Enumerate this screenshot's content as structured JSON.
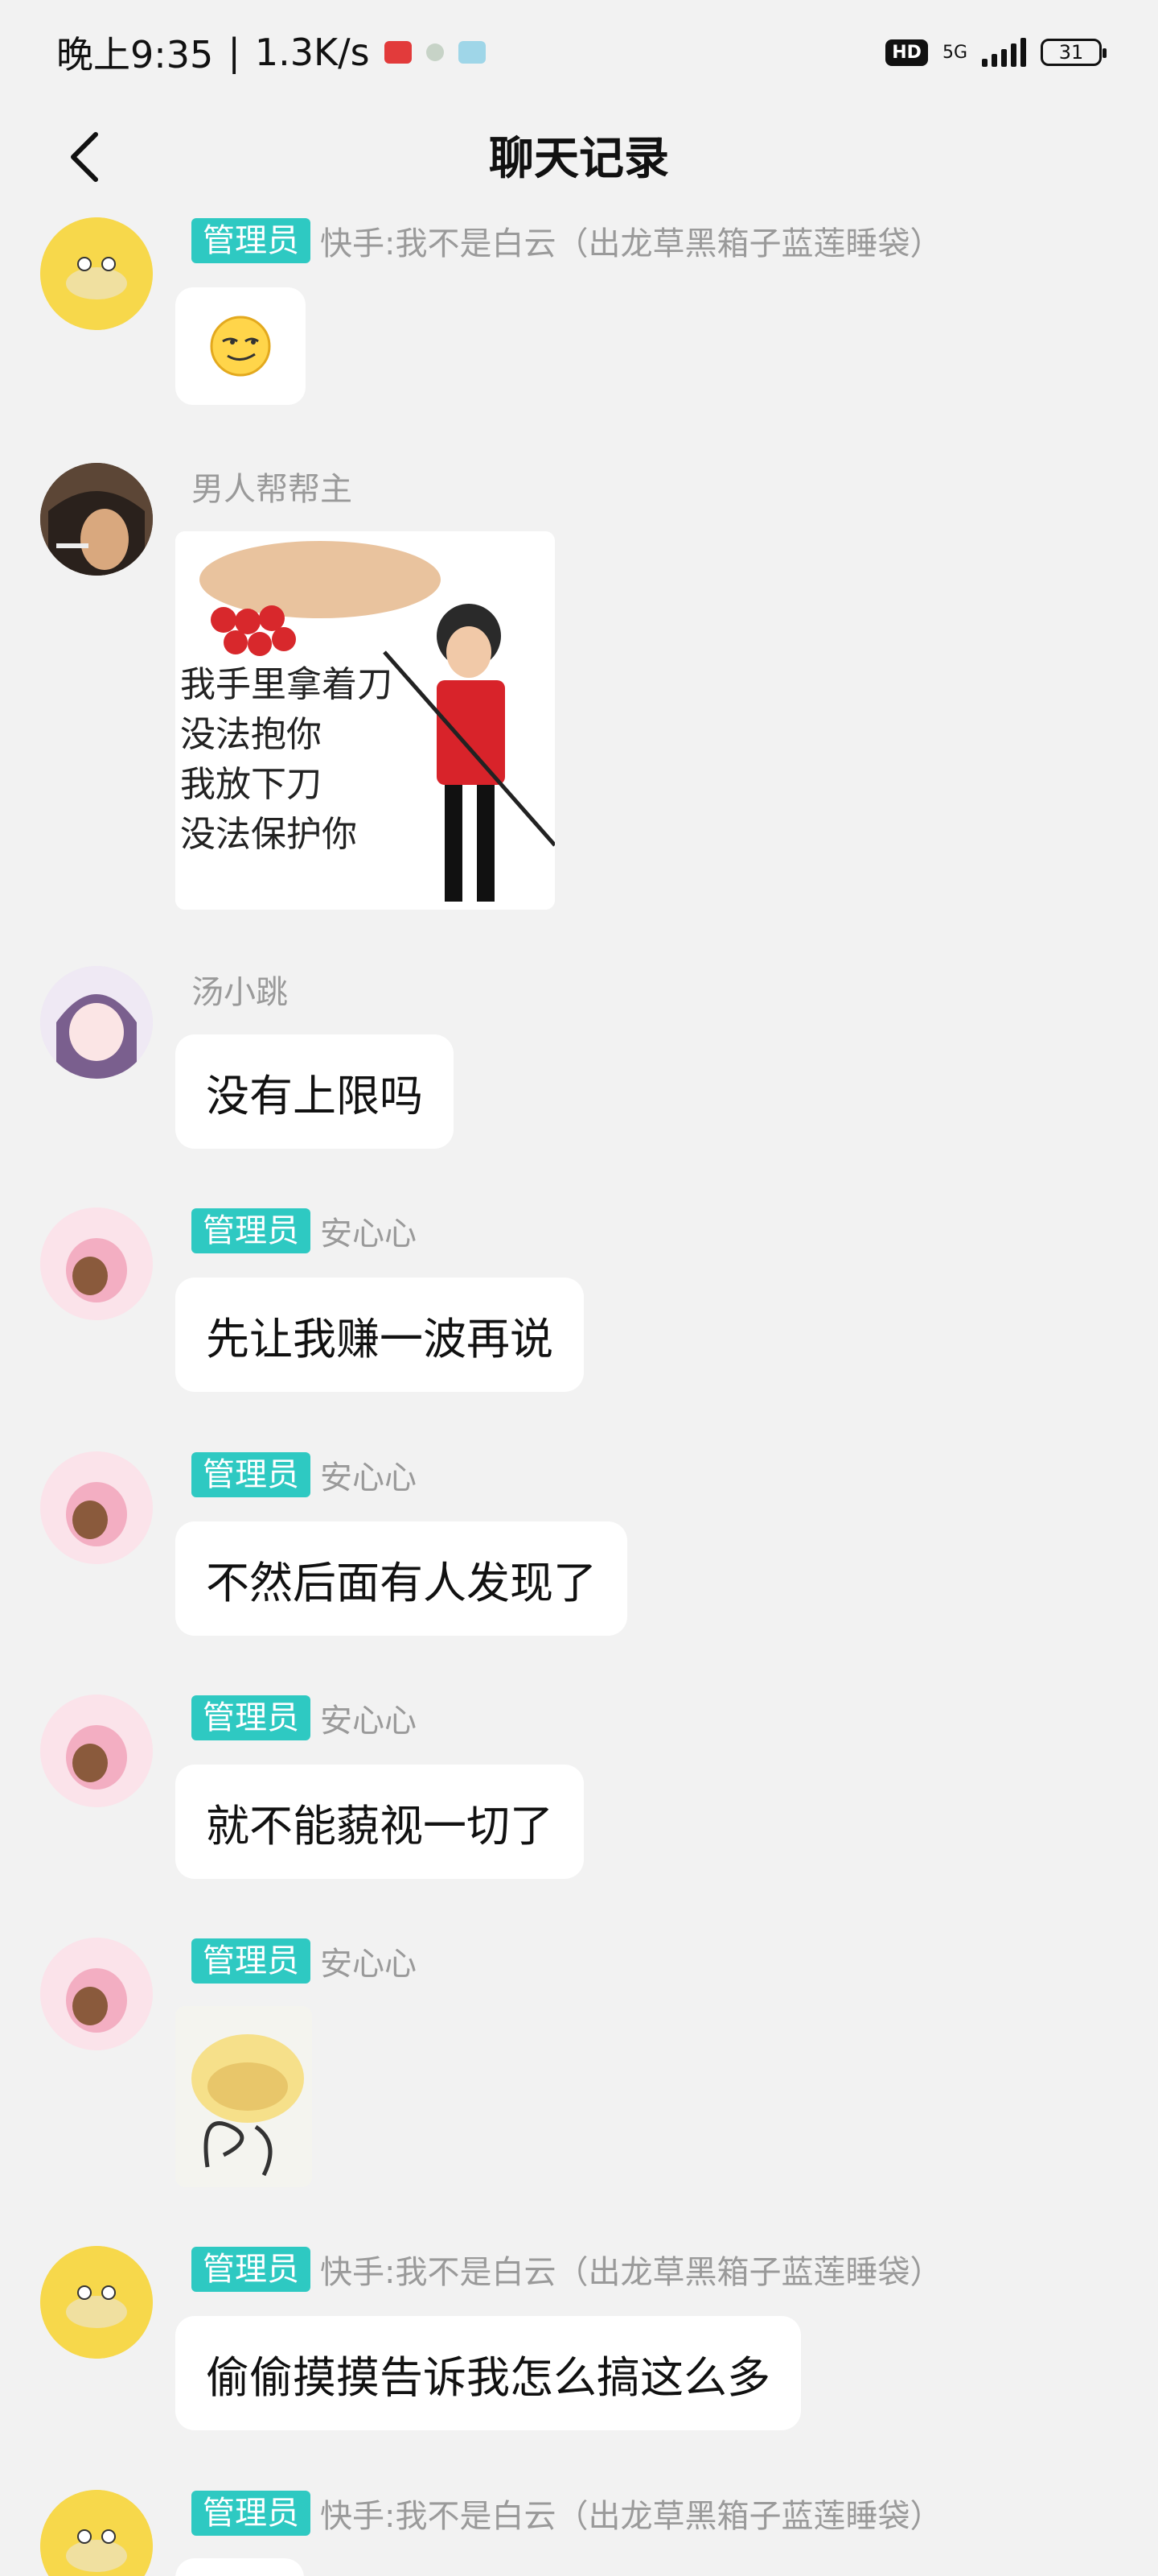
{
  "status": {
    "time": "晚上9:35",
    "speed": "1.3K/s",
    "hd": "HD",
    "network": "5G",
    "battery": "31"
  },
  "header": {
    "title": "聊天记录"
  },
  "messages": [
    {
      "badge": "管理员",
      "sender": "快手:我不是白云（出龙草黑箱子蓝莲睡袋）",
      "type": "emoji"
    },
    {
      "badge": "",
      "sender": "男人帮帮主",
      "type": "image",
      "image_text": [
        "我手里拿着刀",
        "没法抱你",
        "我放下刀",
        "没法保护你"
      ]
    },
    {
      "badge": "",
      "sender": "汤小跳",
      "type": "text",
      "text": "没有上限吗"
    },
    {
      "badge": "管理员",
      "sender": "安心心",
      "type": "text",
      "text": "先让我赚一波再说"
    },
    {
      "badge": "管理员",
      "sender": "安心心",
      "type": "text",
      "text": "不然后面有人发现了"
    },
    {
      "badge": "管理员",
      "sender": "安心心",
      "type": "text",
      "text": "就不能藐视一切了"
    },
    {
      "badge": "管理员",
      "sender": "安心心",
      "type": "sticker"
    },
    {
      "badge": "管理员",
      "sender": "快手:我不是白云（出龙草黑箱子蓝莲睡袋）",
      "type": "text",
      "text": "偷偷摸摸告诉我怎么搞这么多"
    },
    {
      "badge": "管理员",
      "sender": "快手:我不是白云（出龙草黑箱子蓝莲睡袋）",
      "type": "partial"
    }
  ],
  "colors": {
    "badge": "#2ec9c2",
    "background": "#f2f2f2",
    "bubble": "#ffffff"
  }
}
